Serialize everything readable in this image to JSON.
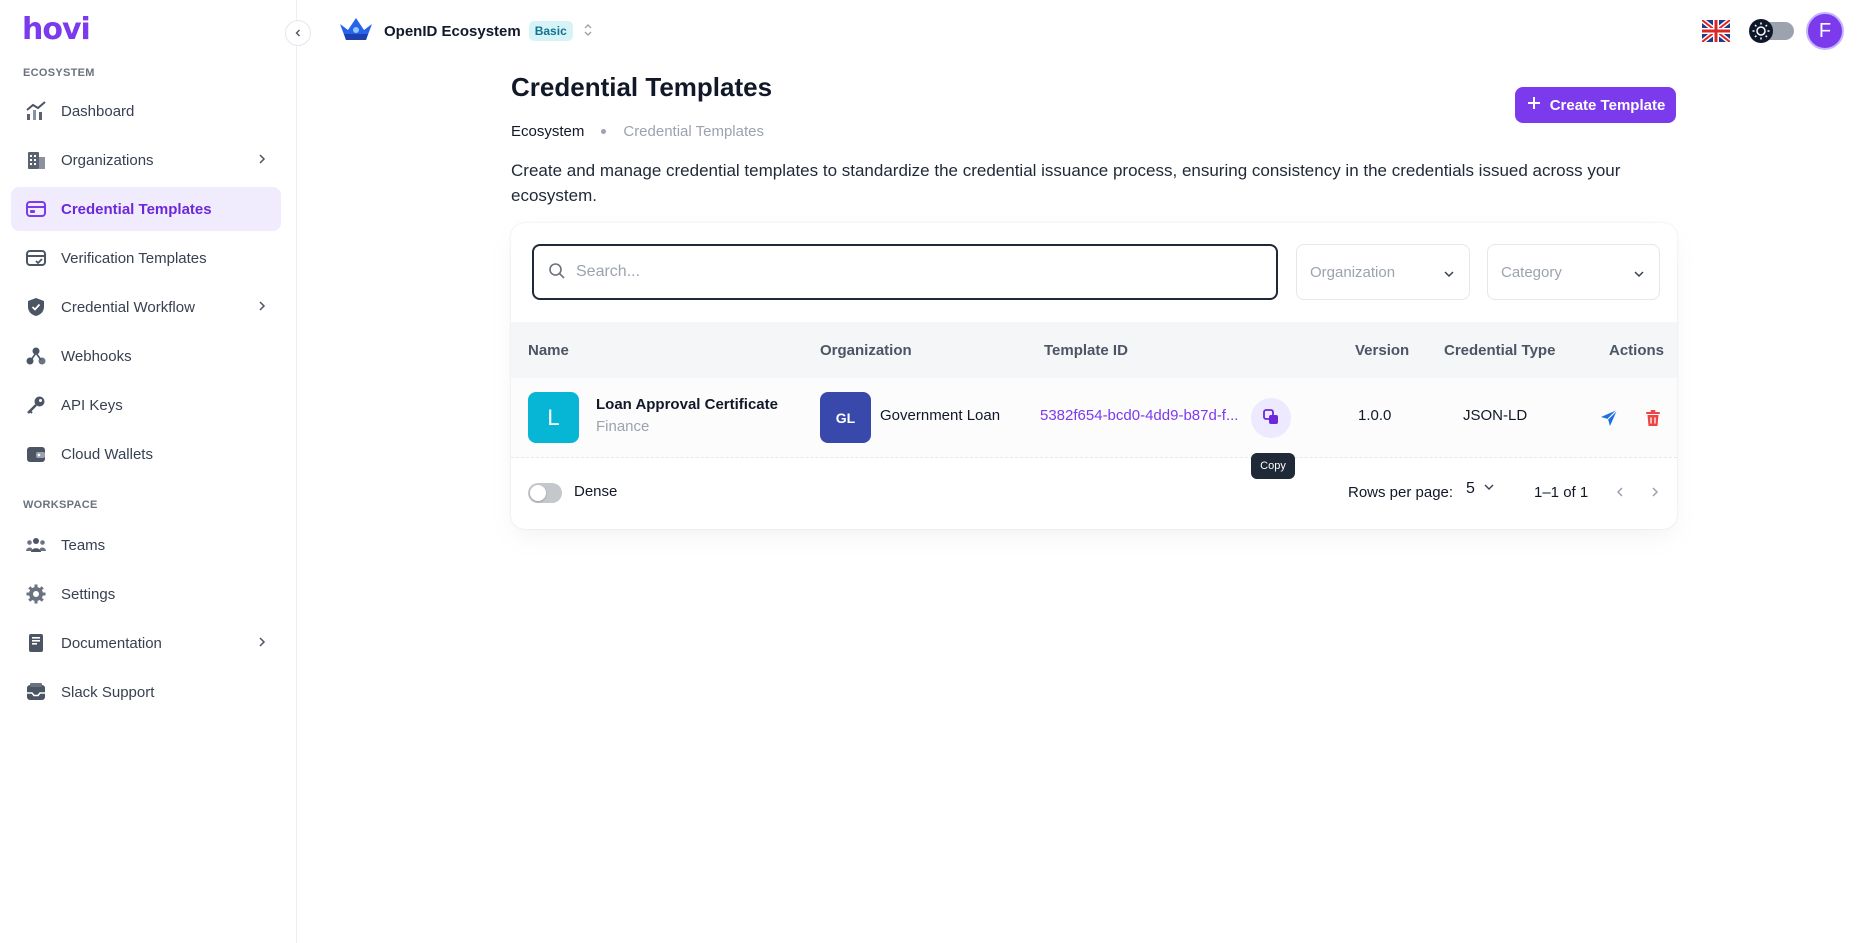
{
  "app": {
    "logo": "hovi"
  },
  "sidebar": {
    "sections": {
      "ecosystem": "ECOSYSTEM",
      "workspace": "WORKSPACE"
    },
    "items": [
      {
        "label": "Dashboard",
        "icon": "chart-line-icon"
      },
      {
        "label": "Organizations",
        "icon": "building-icon"
      },
      {
        "label": "Credential Templates",
        "icon": "credential-card-icon",
        "active": true
      },
      {
        "label": "Verification Templates",
        "icon": "verification-card-icon"
      },
      {
        "label": "Credential Workflow",
        "icon": "shield-check-icon"
      },
      {
        "label": "Webhooks",
        "icon": "webhook-icon"
      },
      {
        "label": "API Keys",
        "icon": "key-icon"
      },
      {
        "label": "Cloud Wallets",
        "icon": "wallet-icon"
      },
      {
        "label": "Teams",
        "icon": "users-icon"
      },
      {
        "label": "Settings",
        "icon": "gear-icon"
      },
      {
        "label": "Documentation",
        "icon": "book-icon"
      },
      {
        "label": "Slack Support",
        "icon": "support-inbox-icon"
      }
    ]
  },
  "topbar": {
    "ecosystem_name": "OpenID Ecosystem",
    "plan_badge": "Basic",
    "avatar_initial": "F",
    "language_icon": "uk-flag-icon"
  },
  "page": {
    "title": "Credential Templates",
    "breadcrumb": [
      "Ecosystem",
      "Credential Templates"
    ],
    "description": "Create and manage credential templates to standardize the credential issuance process, ensuring consistency in the credentials issued across your ecosystem.",
    "create_button": "Create Template"
  },
  "filters": {
    "search_placeholder": "Search...",
    "organization_placeholder": "Organization",
    "category_placeholder": "Category"
  },
  "table": {
    "headers": [
      "Name",
      "Organization",
      "Template ID",
      "Version",
      "Credential Type",
      "Actions"
    ],
    "rows": [
      {
        "initial": "L",
        "name": "Loan Approval Certificate",
        "category": "Finance",
        "org_initials": "GL",
        "organization": "Government Loan",
        "template_id": "5382f654-bcd0-4dd9-b87d-f...",
        "version": "1.0.0",
        "credential_type": "JSON-LD"
      }
    ],
    "copy_tooltip": "Copy"
  },
  "footer": {
    "dense_label": "Dense",
    "rows_per_page_label": "Rows per page:",
    "rows_per_page_value": "5",
    "range": "1–1 of 1"
  },
  "colors": {
    "accent": "#7c3aed",
    "tile_cyan": "#06b6d4",
    "tile_indigo": "#3949ab",
    "delete": "#ef4444",
    "send": "#1d6fe0"
  }
}
